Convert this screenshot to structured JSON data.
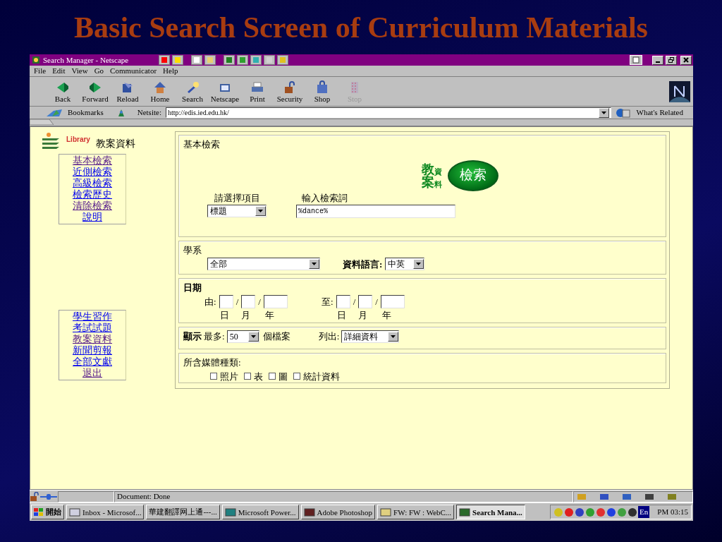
{
  "slide_title": "Basic Search Screen of Curriculum Materials",
  "window": {
    "title": "Search Manager - Netscape"
  },
  "menu": [
    "File",
    "Edit",
    "View",
    "Go",
    "Communicator",
    "Help"
  ],
  "toolbar": [
    {
      "label": "Back",
      "disabled": false
    },
    {
      "label": "Forward",
      "disabled": false
    },
    {
      "label": "Reload",
      "disabled": false
    },
    {
      "label": "Home",
      "disabled": false
    },
    {
      "label": "Search",
      "disabled": false
    },
    {
      "label": "Netscape",
      "disabled": false
    },
    {
      "label": "Print",
      "disabled": false
    },
    {
      "label": "Security",
      "disabled": false
    },
    {
      "label": "Shop",
      "disabled": false
    },
    {
      "label": "Stop",
      "disabled": true
    }
  ],
  "location": {
    "bookmarks": "Bookmarks",
    "label": "Netsite:",
    "url": "http://edis.ied.edu.hk/",
    "related": "What's Related"
  },
  "sidebar": {
    "library": "Library",
    "title": "教案資料",
    "links": [
      {
        "label": "基本檢索",
        "visited": true
      },
      {
        "label": "近側檢索",
        "visited": false
      },
      {
        "label": "高級檢索",
        "visited": false
      },
      {
        "label": "檢索歷史",
        "visited": false
      },
      {
        "label": "清除檢索",
        "visited": true
      },
      {
        "label": "說明",
        "visited": false
      }
    ],
    "links2": [
      {
        "label": "學生習作",
        "visited": false
      },
      {
        "label": "考試試題",
        "visited": false
      },
      {
        "label": "教案資料",
        "visited": true
      },
      {
        "label": "新聞剪報",
        "visited": false
      },
      {
        "label": "全部文獻",
        "visited": false
      },
      {
        "label": "退出",
        "visited": true
      }
    ]
  },
  "search": {
    "heading": "基本檢索",
    "logo_text": [
      "教",
      "資",
      "案",
      "料"
    ],
    "button": "檢索",
    "field_label": "請選擇項目",
    "field_value": "標題",
    "term_label": "輸入檢索詞",
    "term_value": "%dance%",
    "dept_label": "學系",
    "dept_value": "全部",
    "lang_label": "資料語言:",
    "lang_value": "中英",
    "date_heading": "日期",
    "date_from": {
      "label": "由:",
      "separators": [
        "/",
        "/"
      ],
      "units": [
        "日",
        "月",
        "年"
      ]
    },
    "date_to": {
      "label": "至:",
      "separators": [
        "/",
        "/"
      ],
      "units": [
        "日",
        "月",
        "年"
      ]
    },
    "display_label": "顯示",
    "max_label": "最多:",
    "max_value": "50",
    "files_label": "個檔案",
    "list_label": "列出:",
    "list_value": "詳細資料",
    "media_label": "所含媒體種類:",
    "media": [
      {
        "label": "照片",
        "checked": false
      },
      {
        "label": "表",
        "checked": false
      },
      {
        "label": "圖",
        "checked": false
      },
      {
        "label": "統計資料",
        "checked": false
      }
    ]
  },
  "status": "Document: Done",
  "taskbar": {
    "start": "開始",
    "tasks": [
      {
        "label": "Inbox - Microsof...",
        "selected": false
      },
      {
        "label": "華建翻譯网上通---...",
        "selected": false
      },
      {
        "label": "Microsoft Power...",
        "selected": false
      },
      {
        "label": "Adobe Photoshop",
        "selected": false
      },
      {
        "label": "FW: FW : WebC...",
        "selected": false
      },
      {
        "label": "Search Mana...",
        "selected": true
      }
    ],
    "lang": "En",
    "clock": "PM 03:15"
  }
}
